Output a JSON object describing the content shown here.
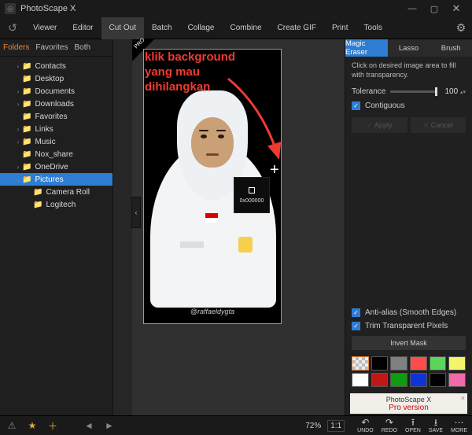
{
  "window": {
    "title": "PhotoScape X"
  },
  "menu": {
    "tabs": [
      "Viewer",
      "Editor",
      "Cut Out",
      "Batch",
      "Collage",
      "Combine",
      "Create GIF",
      "Print",
      "Tools"
    ],
    "active": 2
  },
  "sidebar": {
    "tabs": [
      "Folders",
      "Favorites",
      "Both"
    ],
    "active": 0,
    "tree": [
      {
        "depth": 1,
        "arrow": "›",
        "label": "Contacts"
      },
      {
        "depth": 1,
        "arrow": "",
        "label": "Desktop"
      },
      {
        "depth": 1,
        "arrow": "›",
        "label": "Documents"
      },
      {
        "depth": 1,
        "arrow": "›",
        "label": "Downloads"
      },
      {
        "depth": 1,
        "arrow": "",
        "label": "Favorites"
      },
      {
        "depth": 1,
        "arrow": "›",
        "label": "Links"
      },
      {
        "depth": 1,
        "arrow": "›",
        "label": "Music"
      },
      {
        "depth": 1,
        "arrow": "",
        "label": "Nox_share"
      },
      {
        "depth": 1,
        "arrow": "›",
        "label": "OneDrive"
      },
      {
        "depth": 1,
        "arrow": "⌄",
        "label": "Pictures",
        "selected": true
      },
      {
        "depth": 2,
        "arrow": "",
        "label": "Camera Roll"
      },
      {
        "depth": 2,
        "arrow": "",
        "label": "Logitech"
      }
    ]
  },
  "overlay": {
    "line1": "klik background",
    "line2": "yang mau",
    "line3": "dihilangkan"
  },
  "tooltip": {
    "hex": "0x000000"
  },
  "watermark": "@raffaeldygta",
  "right": {
    "tabs": [
      "Magic Eraser",
      "Lasso",
      "Brush"
    ],
    "active": 0,
    "hint": "Click on desired image area to fill with transparency.",
    "tolerance_label": "Tolerance",
    "tolerance_value": "100",
    "contiguous": "Contiguous",
    "apply": "Apply",
    "cancel": "Cancel",
    "antialias": "Anti-alias (Smooth Edges)",
    "trim": "Trim Transparent Pixels",
    "invert": "Invert Mask",
    "swatches": [
      "checker",
      "#000000",
      "#808080",
      "#ff4d4d",
      "#5bd65b",
      "#f5f56b",
      "#ffffff",
      "#c01818",
      "#109b10",
      "#1033d6",
      "#000000",
      "#f06aa8"
    ],
    "promo_name": "PhotoScape X",
    "promo_pro": "Pro version"
  },
  "status": {
    "zoom": "72%",
    "ratio": "1:1",
    "undo": "UNDO",
    "redo": "REDO",
    "open": "OPEN",
    "save": "SAVE",
    "more": "MORE"
  }
}
